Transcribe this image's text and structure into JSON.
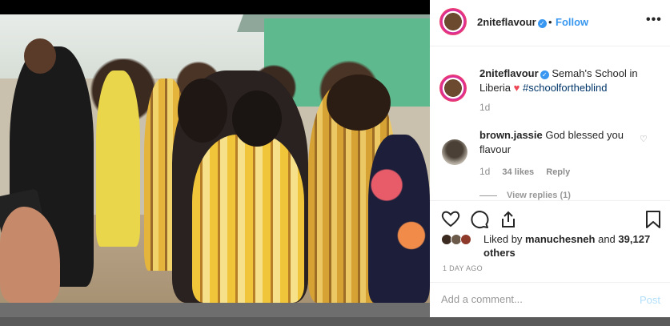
{
  "post": {
    "username": "2niteflavour",
    "follow_label": "Follow",
    "dot": "•",
    "more_icon": "more-horizontal-icon",
    "verified_icon": "verified-badge-icon",
    "image_alt": "Photo of a man hugging a child in a crowd of students wearing kente-print uniforms outside a school"
  },
  "caption": {
    "username": "2niteflavour",
    "text_before": "Semah's School in Liberia",
    "heart": "♥",
    "hashtag": "#schoolfortheblind",
    "time": "1d"
  },
  "comments": [
    {
      "username": "brown.jassie",
      "text": "God blessed you flavour",
      "time": "1d",
      "likes": "34 likes",
      "reply_label": "Reply",
      "view_replies": "View replies (1)"
    }
  ],
  "actions": {
    "like_icon": "heart-outline-icon",
    "comment_icon": "comment-bubble-icon",
    "share_icon": "share-icon",
    "save_icon": "bookmark-icon"
  },
  "likes": {
    "prefix": "Liked by",
    "user": "manuchesneh",
    "and": "and",
    "others": "39,127 others"
  },
  "timestamp": "1 DAY AGO",
  "add_comment": {
    "placeholder": "Add a comment...",
    "post_label": "Post"
  },
  "colors": {
    "accent_blue": "#3897f0",
    "heart_red": "#ed4956",
    "post_disabled": "#b2dffc",
    "text_secondary": "#8e8e8e"
  }
}
